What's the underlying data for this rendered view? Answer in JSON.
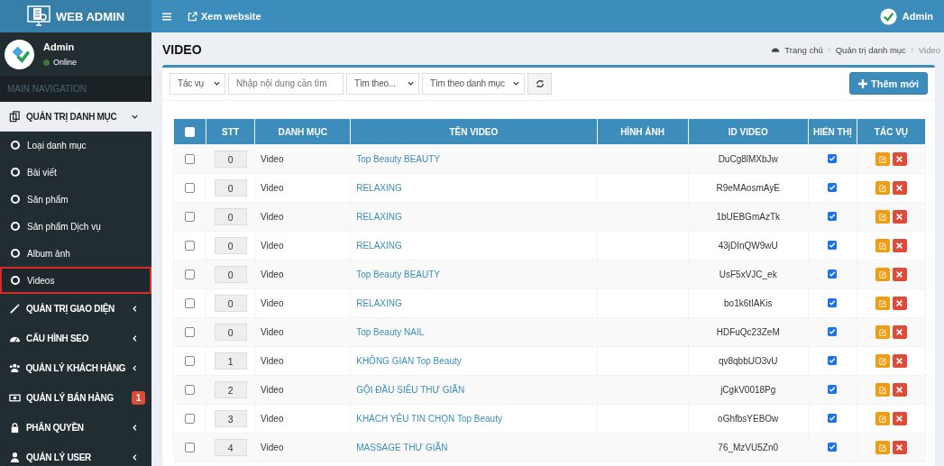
{
  "header": {
    "brand": "WEB ADMIN",
    "view_site": "Xem website",
    "user": "Admin"
  },
  "sidebar": {
    "user": {
      "name": "Admin",
      "status": "Online"
    },
    "nav_heading": "MAIN NAVIGATION",
    "items": [
      {
        "label": "QUẢN TRỊ DANH MỤC",
        "expanded": true,
        "children": [
          {
            "label": "Loại danh mục",
            "selected": false
          },
          {
            "label": "Bài viết",
            "selected": false
          },
          {
            "label": "Sản phẩm",
            "selected": false
          },
          {
            "label": "Sản phẩm Dịch vụ",
            "selected": false
          },
          {
            "label": "Album ảnh",
            "selected": false
          },
          {
            "label": "Videos",
            "selected": true
          }
        ]
      },
      {
        "label": "QUẢN TRỊ GIAO DIỆN",
        "expanded": false
      },
      {
        "label": "CẤU HÌNH SEO",
        "expanded": false
      },
      {
        "label": "QUẢN LÝ KHÁCH HÀNG",
        "expanded": false
      },
      {
        "label": "QUẢN LÝ BÁN HÀNG",
        "badge": "1"
      },
      {
        "label": "PHÂN QUYỀN",
        "expanded": false
      },
      {
        "label": "QUẢN LÝ USER",
        "expanded": false
      }
    ]
  },
  "page": {
    "title": "VIDEO",
    "breadcrumb": [
      "Trang chủ",
      "Quản trị danh mục",
      "Video"
    ]
  },
  "toolbar": {
    "action_select": "Tác vụ",
    "search": {
      "placeholder": "Nhập nội dung cần tìm"
    },
    "search_by_select": "Tìm theo...",
    "category_select": "Tìm theo danh mục",
    "add_button": "Thêm mới"
  },
  "table": {
    "select_all_checked": false,
    "columns": [
      "STT",
      "DANH MỤC",
      "TÊN VIDEO",
      "HÌNH ẢNH",
      "ID VIDEO",
      "HIỂN THỊ",
      "TÁC VỤ"
    ],
    "rows": [
      {
        "checked": false,
        "stt": "0",
        "category": "Video",
        "name": "Top Beauty BEAUTY",
        "video_id": "DuCg8lMXbJw",
        "visible": true
      },
      {
        "checked": false,
        "stt": "0",
        "category": "Video",
        "name": "RELAXING",
        "video_id": "R9eMAosmAyE",
        "visible": true
      },
      {
        "checked": false,
        "stt": "0",
        "category": "Video",
        "name": "RELAXING",
        "video_id": "1bUEBGmAzTk",
        "visible": true
      },
      {
        "checked": false,
        "stt": "0",
        "category": "Video",
        "name": "RELAXING",
        "video_id": "43jDInQW9wU",
        "visible": true
      },
      {
        "checked": false,
        "stt": "0",
        "category": "Video",
        "name": "Top Beauty BEAUTY",
        "video_id": "UsF5xVJC_ek",
        "visible": true
      },
      {
        "checked": false,
        "stt": "0",
        "category": "Video",
        "name": "RELAXING",
        "video_id": "bo1k6tIAKis",
        "visible": true
      },
      {
        "checked": false,
        "stt": "0",
        "category": "Video",
        "name": "Top Beauty NAIL",
        "video_id": "HDFuQc23ZeM",
        "visible": true
      },
      {
        "checked": false,
        "stt": "1",
        "category": "Video",
        "name": "KHÔNG GIAN Top Beauty",
        "video_id": "qv8qbbUO3vU",
        "visible": true
      },
      {
        "checked": false,
        "stt": "2",
        "category": "Video",
        "name": "GỘI ĐẦU SIÊU THƯ GIÃN",
        "video_id": "jCgkV0018Pg",
        "visible": true
      },
      {
        "checked": false,
        "stt": "3",
        "category": "Video",
        "name": "KHÁCH YÊU TIN CHỌN Top Beauty",
        "video_id": "oGhfbsYEBOw",
        "visible": true
      },
      {
        "checked": false,
        "stt": "4",
        "category": "Video",
        "name": "MASSAGE THƯ GIÃN",
        "video_id": "76_MzVU5Zn0",
        "visible": true
      }
    ]
  }
}
